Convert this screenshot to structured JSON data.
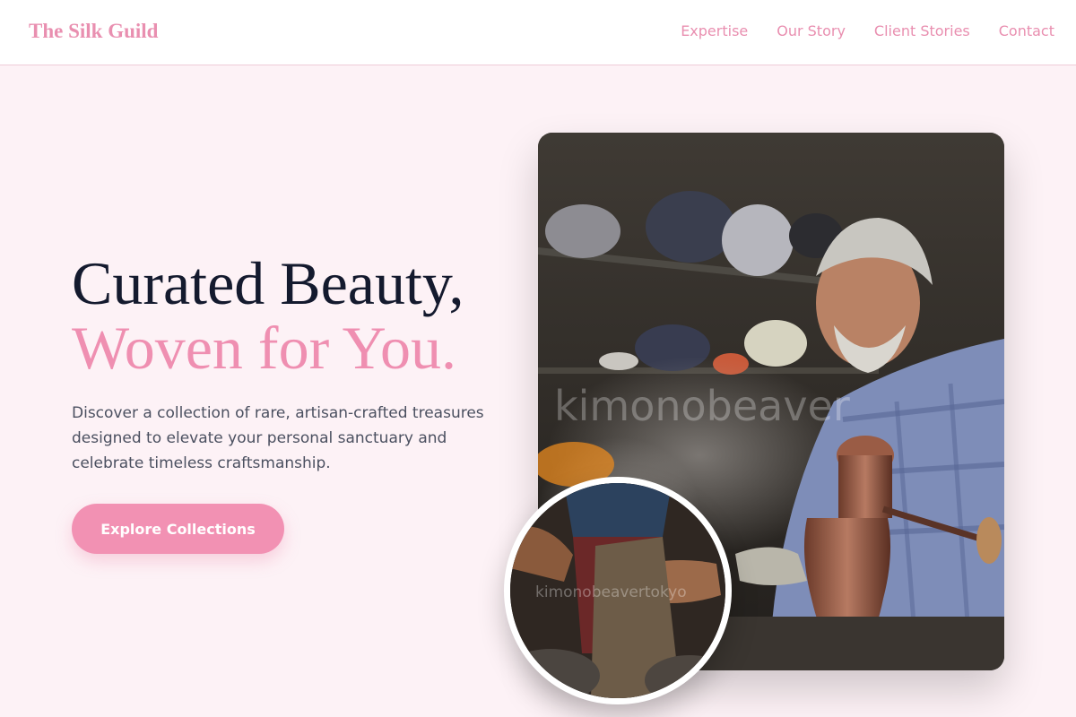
{
  "brand": {
    "name": "The Silk Guild"
  },
  "nav": {
    "items": [
      {
        "label": "Expertise"
      },
      {
        "label": "Our Story"
      },
      {
        "label": "Client Stories"
      },
      {
        "label": "Contact"
      }
    ]
  },
  "hero": {
    "title_line1": "Curated Beauty,",
    "title_line2": "Woven for You.",
    "description": "Discover a collection of rare, artisan-crafted treasures designed to elevate your personal sanctuary and celebrate timeless craftsmanship.",
    "cta_label": "Explore Collections"
  },
  "images": {
    "main_watermark": "kimonobeaver",
    "inset_watermark": "kimonobeavertokyo"
  },
  "colors": {
    "accent": "#ef8fb1",
    "title_dark": "#141a2e",
    "background": "#fdf2f6",
    "header_background": "#ffffff"
  }
}
